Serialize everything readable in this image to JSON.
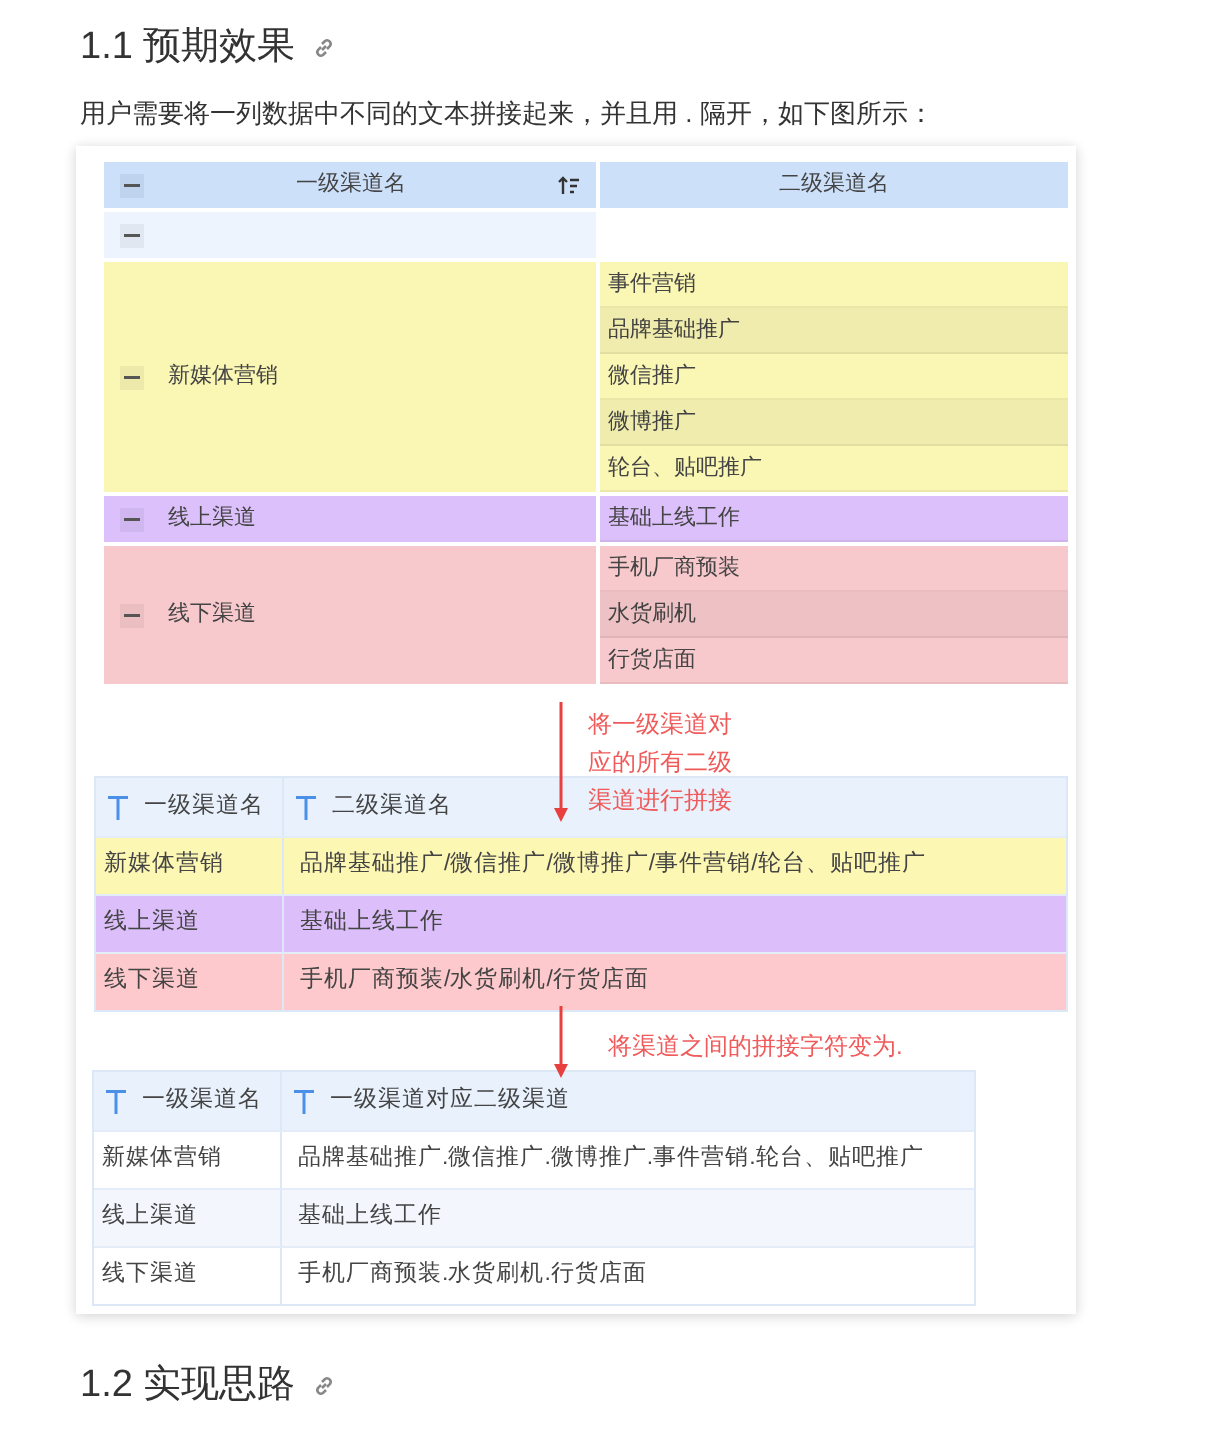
{
  "heading": "1.1 预期效果",
  "intro": "用户需要将一列数据中不同的文本拼接起来，并且用 . 隔开，如下图所示：",
  "table_1": {
    "columns": [
      "一级渠道名",
      "二级渠道名"
    ],
    "rows": [
      {
        "color": "#eef4fe",
        "children": []
      },
      {
        "label": "新媒体营销",
        "color": "#faf6b4",
        "children": [
          "事件营销",
          "品牌基础推广",
          "微信推广",
          "微博推广",
          "轮台、贴吧推广"
        ]
      },
      {
        "label": "线上渠道",
        "color": "#dcc0fb",
        "children": [
          "基础上线工作"
        ]
      },
      {
        "label": "线下渠道",
        "color": "#f8c9cc",
        "children": [
          "手机厂商预装",
          "水货刷机",
          "行货店面"
        ]
      }
    ]
  },
  "annotation_1": [
    "将一级渠道对",
    "应的所有二级",
    "渠道进行拼接"
  ],
  "table_2": {
    "columns": [
      "一级渠道名",
      "二级渠道名"
    ],
    "rows": [
      {
        "color": "#fdf7b4",
        "cells": [
          "新媒体营销",
          "品牌基础推广/微信推广/微博推广/事件营销/轮台、贴吧推广"
        ]
      },
      {
        "color": "#dcbffa",
        "cells": [
          "线上渠道",
          "基础上线工作"
        ]
      },
      {
        "color": "#fdc9cc",
        "cells": [
          "线下渠道",
          "手机厂商预装/水货刷机/行货店面"
        ]
      }
    ]
  },
  "annotation_2": "将渠道之间的拼接字符变为.",
  "table_3": {
    "columns": [
      "一级渠道名",
      "一级渠道对应二级渠道"
    ],
    "rows": [
      {
        "cells": [
          "新媒体营销",
          "品牌基础推广.微信推广.微博推广.事件营销.轮台、贴吧推广"
        ]
      },
      {
        "cells": [
          "线上渠道",
          "基础上线工作"
        ]
      },
      {
        "cells": [
          "线下渠道",
          "手机厂商预装.水货刷机.行货店面"
        ]
      }
    ]
  },
  "heading_2": "1.2 实现思路"
}
